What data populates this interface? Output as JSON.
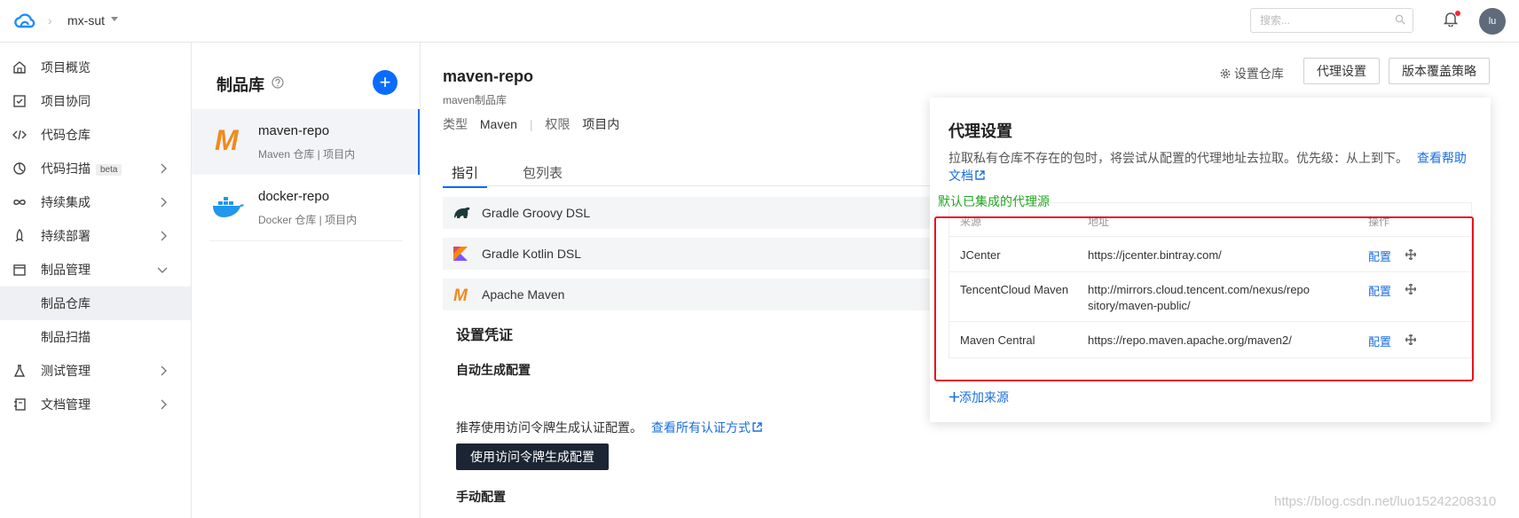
{
  "topbar": {
    "project": "mx-sut",
    "search_placeholder": "搜索...",
    "avatar_text": "lu"
  },
  "sidebar": {
    "items": [
      {
        "label": "项目概览",
        "icon": "home-icon"
      },
      {
        "label": "项目协同",
        "icon": "check-square-icon"
      },
      {
        "label": "代码仓库",
        "icon": "code-icon"
      },
      {
        "label": "代码扫描",
        "icon": "scan-icon",
        "badge": "beta"
      },
      {
        "label": "持续集成",
        "icon": "infinity-icon"
      },
      {
        "label": "持续部署",
        "icon": "rocket-icon"
      },
      {
        "label": "制品管理",
        "icon": "box-icon"
      },
      {
        "label": "制品仓库"
      },
      {
        "label": "制品扫描"
      },
      {
        "label": "测试管理",
        "icon": "flask-icon"
      },
      {
        "label": "文档管理",
        "icon": "book-icon"
      }
    ]
  },
  "repolist": {
    "title": "制品库",
    "add_label": "+",
    "repos": [
      {
        "name": "maven-repo",
        "sub": "Maven 仓库 | 项目内"
      },
      {
        "name": "docker-repo",
        "sub": "Docker 仓库 | 项目内"
      }
    ]
  },
  "main": {
    "title": "maven-repo",
    "subtitle": "maven制品库",
    "type_label": "类型",
    "type_value": "Maven",
    "perm_label": "权限",
    "perm_value": "项目内",
    "settings_link": "设置仓库",
    "proxy_btn": "代理设置",
    "version_btn": "版本覆盖策略",
    "tabs": [
      "指引",
      "包列表"
    ],
    "guides": [
      "Gradle Groovy DSL",
      "Gradle Kotlin DSL",
      "Apache Maven"
    ],
    "credentials_title": "设置凭证",
    "auto_title": "自动生成配置",
    "rec_text": "推荐使用访问令牌生成认证配置。",
    "rec_link": "查看所有认证方式",
    "token_btn": "使用访问令牌生成配置",
    "manual_title": "手动配置"
  },
  "proxy": {
    "title": "代理设置",
    "desc": "拉取私有仓库不存在的包时，将尝试从配置的代理地址去拉取。优先级：从上到下。",
    "help_link": "查看帮助文档",
    "note": "默认已集成的代理源",
    "headers": [
      "来源",
      "地址",
      "操作"
    ],
    "rows": [
      {
        "source": "JCenter",
        "url": "https://jcenter.bintray.com/",
        "action": "配置"
      },
      {
        "source": "TencentCloud Maven",
        "url": "http://mirrors.cloud.tencent.com/nexus/repository/maven-public/",
        "action": "配置"
      },
      {
        "source": "Maven Central",
        "url": "https://repo.maven.apache.org/maven2/",
        "action": "配置"
      }
    ],
    "add_source": "添加来源"
  },
  "watermark": "https://blog.csdn.net/luo15242208310"
}
